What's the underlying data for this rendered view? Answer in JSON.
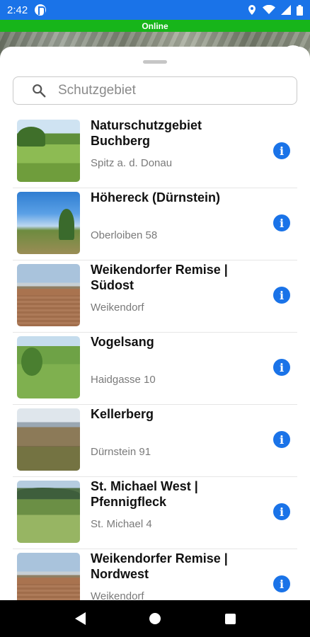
{
  "status_bar": {
    "time": "2:42",
    "icons": [
      "app-notification-icon",
      "location-icon",
      "wifi-icon",
      "signal-icon",
      "battery-icon"
    ]
  },
  "banner": {
    "text": "Online",
    "color": "#17b51a"
  },
  "search": {
    "placeholder": "Schutzgebiet",
    "value": ""
  },
  "list": {
    "items": [
      {
        "title": "Naturschutzgebiet Buchberg",
        "subtitle": "Spitz a. d. Donau",
        "thumb": "meadow"
      },
      {
        "title": "Höhereck (Dürnstein)",
        "subtitle": "Oberloiben 58",
        "thumb": "sky"
      },
      {
        "title": "Weikendorfer Remise | Südost",
        "subtitle": "Weikendorf",
        "thumb": "field"
      },
      {
        "title": "Vogelsang",
        "subtitle": "Haidgasse 10",
        "thumb": "orchard"
      },
      {
        "title": "Kellerberg",
        "subtitle": "Dürnstein 91",
        "thumb": "hill"
      },
      {
        "title": "St. Michael West | Pfennigfleck",
        "subtitle": "St. Michael 4",
        "thumb": "valley"
      },
      {
        "title": "Weikendorfer Remise | Nordwest",
        "subtitle": "Weikendorf",
        "thumb": "field"
      }
    ]
  },
  "colors": {
    "accent": "#1a73e8",
    "online": "#17b51a"
  }
}
